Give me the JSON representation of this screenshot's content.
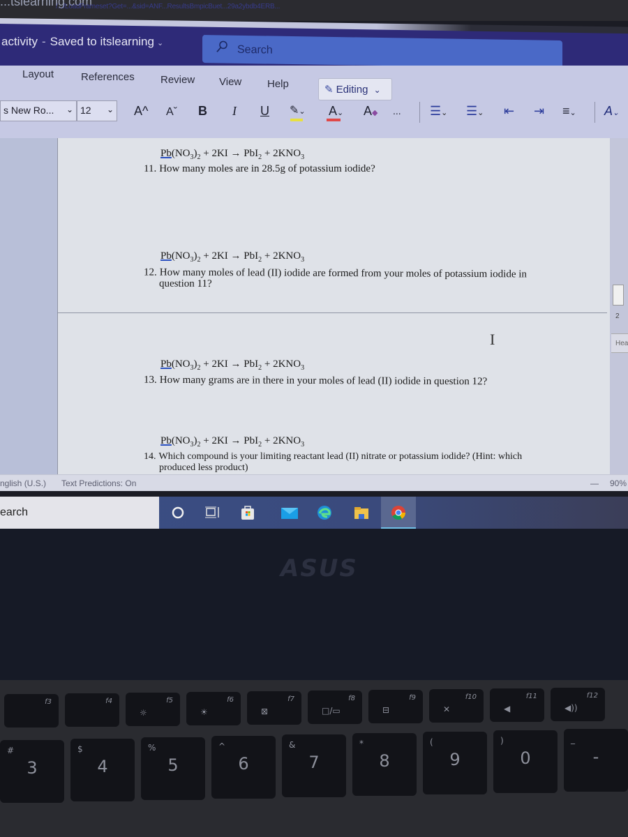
{
  "browser": {
    "url_domain": "...tslearning.com",
    "url_rest": "/.../LoadFrameset?Get=...&sid=ANF...ResultsBmpicBuet...29a2ybdb4ERB..."
  },
  "titlebar": {
    "doc_title": "activity",
    "separator": "-",
    "save_status": "Saved to itslearning",
    "save_chevron": "⌄",
    "search_icon": "⌕",
    "search_label": "Search"
  },
  "ribbon": {
    "tabs": [
      "Layout",
      "References",
      "Review",
      "View",
      "Help"
    ],
    "editing_label": "Editing",
    "editing_icon": "✎",
    "chevron": "⌄",
    "font_name": "s New Ro...",
    "font_size": "12",
    "grow_font": "A^",
    "shrink_font": "Aˇ",
    "bold": "B",
    "italic": "I",
    "underline": "U",
    "highlight_icon": "✎",
    "font_color_icon": "A",
    "clear_format_icon": "A",
    "more": "...",
    "bullets_icon": "☰",
    "numbering_icon": "☰",
    "outdent_icon": "⇤",
    "indent_icon": "⇥",
    "align_icon": "≡",
    "styles_icon": "A",
    "highlight_color": "#e8e040",
    "font_color": "#e04848"
  },
  "document": {
    "equation": {
      "pb": "Pb",
      "part1": "(NO",
      "sub3": "3",
      "part2": ")",
      "sub2": "2",
      "part3": " + 2KI → PbI",
      "sub2b": "2",
      "part4": " + 2KNO",
      "sub3b": "3"
    },
    "questions": [
      {
        "number": "11.",
        "text": "How many moles are in 28.5g of potassium iodide?",
        "cont": ""
      },
      {
        "number": "12.",
        "text": "How many moles of lead (II) iodide are formed from your moles of potassium iodide in",
        "cont": "question 11?"
      },
      {
        "number": "13.",
        "text": "How many grams are in there in your moles of lead (II) iodide in question 12?",
        "cont": ""
      },
      {
        "number": "14.",
        "text": "Which compound is your limiting reactant lead (II) nitrate or potassium iodide? (Hint: which",
        "cont": "produced less product)"
      }
    ],
    "cursor": "I"
  },
  "right_pane": {
    "page_number": "2",
    "heading_label": "Hea"
  },
  "statusbar": {
    "language": "nglish (U.S.)",
    "text_predictions": "Text Predictions: On",
    "zoom_minus": "—",
    "zoom_level": "90%"
  },
  "taskbar": {
    "search_label": "earch",
    "apps": [
      "cortana",
      "task-view",
      "store",
      "mail",
      "edge",
      "file-explorer",
      "chrome"
    ],
    "active_app": "chrome"
  },
  "laptop": {
    "brand": "ASUS",
    "fn_keys": [
      {
        "fn": "f3",
        "glyph": ""
      },
      {
        "fn": "f4",
        "glyph": ""
      },
      {
        "fn": "f5",
        "glyph": "☼"
      },
      {
        "fn": "f6",
        "glyph": "☀"
      },
      {
        "fn": "f7",
        "glyph": "⊠"
      },
      {
        "fn": "f8",
        "glyph": "□/▭"
      },
      {
        "fn": "f9",
        "glyph": "⊟"
      },
      {
        "fn": "f10",
        "glyph": "✕"
      },
      {
        "fn": "f11",
        "glyph": "◀"
      },
      {
        "fn": "f12",
        "glyph": "◀))"
      }
    ],
    "number_keys": [
      {
        "main": "3",
        "sym": "#"
      },
      {
        "main": "4",
        "sym": "$"
      },
      {
        "main": "5",
        "sym": "%"
      },
      {
        "main": "6",
        "sym": "^"
      },
      {
        "main": "7",
        "sym": "&"
      },
      {
        "main": "8",
        "sym": "*"
      },
      {
        "main": "9",
        "sym": "("
      },
      {
        "main": "0",
        "sym": ")"
      },
      {
        "main": "-",
        "sym": "_"
      }
    ]
  }
}
